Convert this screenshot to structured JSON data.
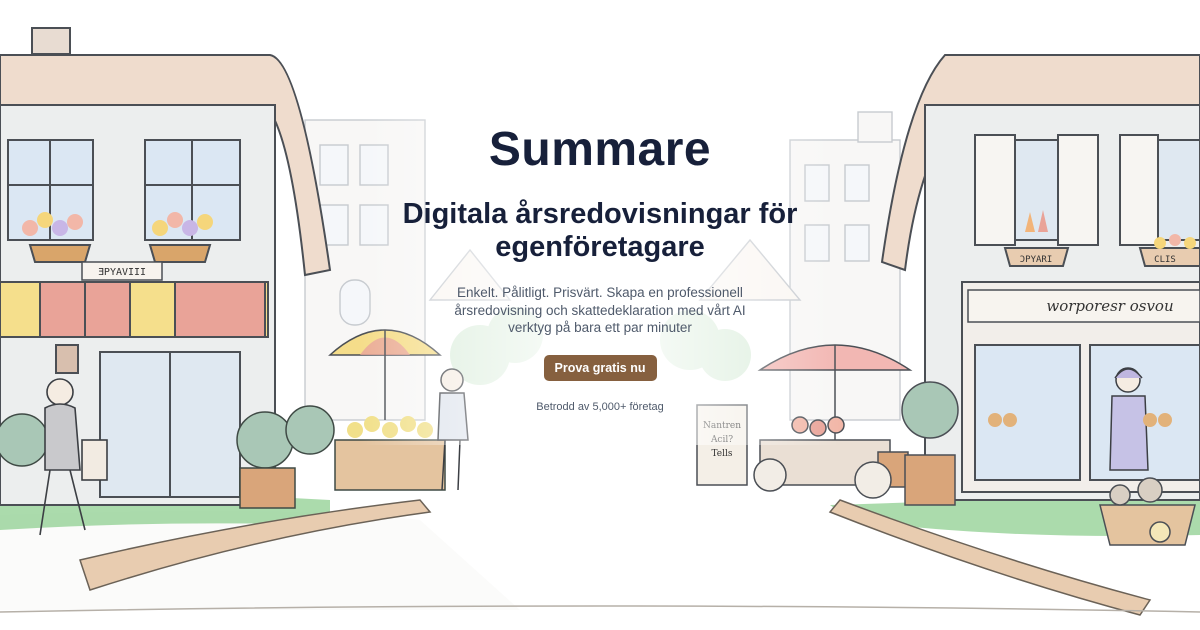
{
  "brand": "Summare",
  "headline": "Digitala årsredovisningar för egenföretagare",
  "subheadline": "Enkelt. Pålitligt. Prisvärt. Skapa en professionell årsredovisning och skattedeklaration med vårt AI verktyg på bara ett par minuter",
  "cta_label": "Prova gratis nu",
  "trust_text": "Betrodd av 5,000+ företag",
  "illustration": {
    "left_shop_sign": "ƎPYAVIII",
    "right_shop_sign": "ƆPYARI",
    "right_shop_small_sign": "CLIS",
    "storefront_banner": "worporesr osvou",
    "chalkboard_sign": "Nantren Acil? Tells"
  },
  "colors": {
    "cta": "#86603f",
    "heading": "#17203a",
    "body_text": "#4f5a6b",
    "awning_yellow": "#f5df8c",
    "awning_red": "#e9a398",
    "grass": "#8fcf90"
  }
}
